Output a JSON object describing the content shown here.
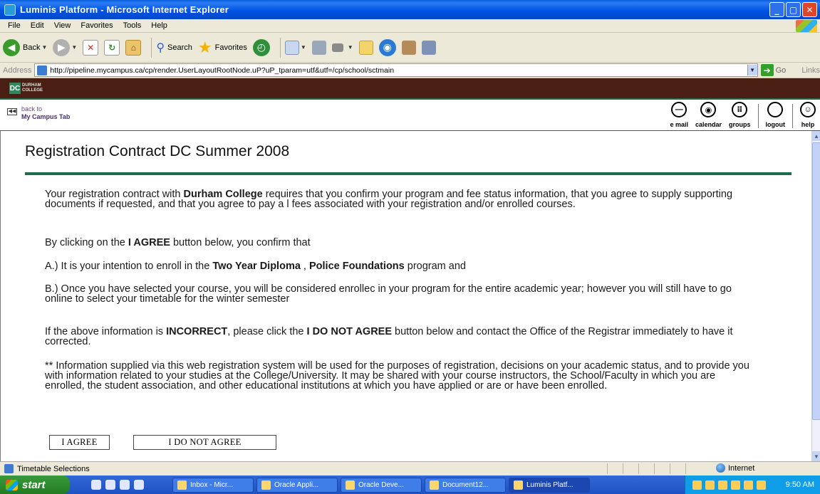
{
  "window": {
    "title": "Luminis Platform - Microsoft Internet Explorer"
  },
  "menu": [
    "File",
    "Edit",
    "View",
    "Favorites",
    "Tools",
    "Help"
  ],
  "toolbar": {
    "back_label": "Back",
    "search_label": "Search",
    "favorites_label": "Favorites"
  },
  "address": {
    "label": "Address",
    "url": "http://pipeline.mycampus.ca/cp/render.UserLayoutRootNode.uP?uP_tparam=utf&utf=/cp/school/sctmain",
    "go_label": "Go",
    "links_label": "Links"
  },
  "portal": {
    "brand": "DURHAM COLLEGE",
    "back_line1": "back to",
    "back_line2": "My Campus Tab",
    "nav": [
      {
        "label": "e mail",
        "icon": "email-icon"
      },
      {
        "label": "calendar",
        "icon": "calendar-icon"
      },
      {
        "label": "groups",
        "icon": "groups-icon"
      },
      {
        "label": "logout",
        "icon": "logout-icon"
      },
      {
        "label": "help",
        "icon": "help-icon"
      }
    ]
  },
  "page": {
    "title": "Registration Contract DC Summer 2008",
    "para1_a": "Your registration contract with ",
    "para1_b": "Durham College",
    "para1_c": " requires that you confirm your program and fee status information, that you agree to supply supporting documents if requested, and that you agree to pay a l fees associated with your registration and/or enrolled courses.",
    "para2_a": "By clicking on the ",
    "para2_b": "I AGREE",
    "para2_c": " button below, you confirm that",
    "para3_a": "A.) It is your intention to enroll in the ",
    "para3_b": "Two Year Diploma",
    "para3_c": " , ",
    "para3_d": "Police Foundations",
    "para3_e": " program and",
    "para4": "B.) Once you have selected your course, you will be considered enrollec in your program for the entire academic year; however you will still have to go online to select your timetable for the winter semester",
    "para5_a": "If the above information is ",
    "para5_b": "INCORRECT",
    "para5_c": ", please click the ",
    "para5_d": "I DO NOT AGREE",
    "para5_e": " button below and contact the Office of the Registrar immediately to have it corrected.",
    "para6": "** Information supplied via this web registration system will be used for the purposes of registration, decisions on your academic status, and to provide you with information related to your studies at the College/University. It may be shared with your course instructors, the School/Faculty in which you are enrolled, the student association, and other educational institutions at which you have applied or are or have been enrolled.",
    "agree_button": "I AGREE",
    "disagree_button": "I DO NOT AGREE"
  },
  "status": {
    "text": "Timetable Selections",
    "zone": "Internet"
  },
  "taskbar": {
    "start": "start",
    "tasks": [
      "Inbox - Micr...",
      "Oracle Appli...",
      "Oracle Deve...",
      "Document12...",
      "Luminis Platf..."
    ],
    "clock": "9:50 AM"
  },
  "colors": {
    "accent_green": "#1e6d4a",
    "brand_bar": "#4a1e12",
    "link_purple": "#4a2f6e"
  }
}
